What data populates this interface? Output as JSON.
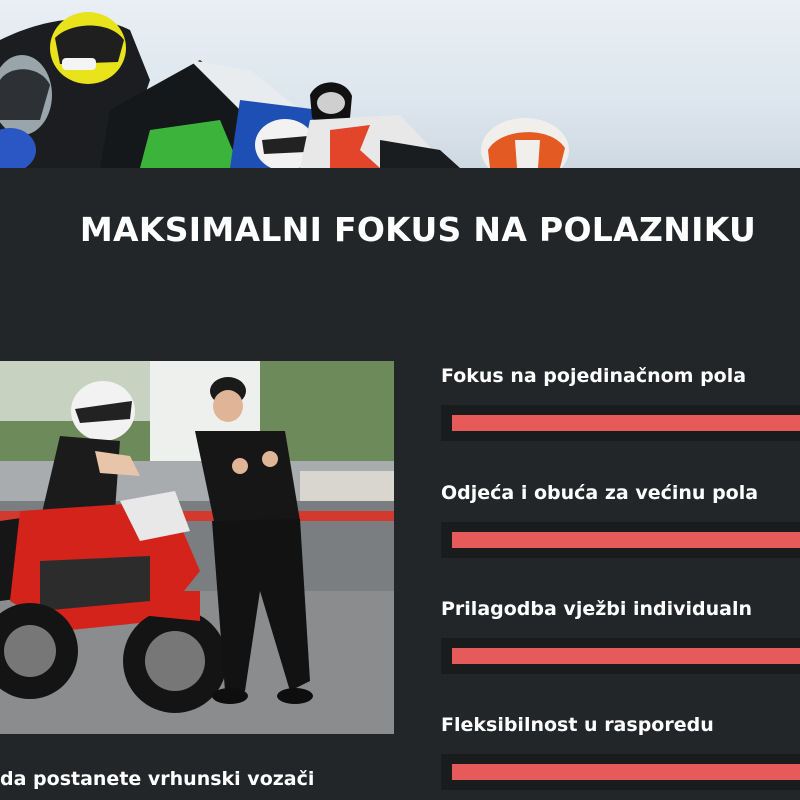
{
  "section": {
    "title": "MAKSIMALNI FOKUS NA POLAZNIKU"
  },
  "photo": {
    "caption": "da postanete vrhunski vozači"
  },
  "skills": [
    {
      "label": "Fokus na pojedinačnom pola",
      "level": 1.0
    },
    {
      "label": "Odjeća i obuća za većinu pola",
      "level": 1.0
    },
    {
      "label": "Prilagodba vježbi individualn",
      "level": 1.0
    },
    {
      "label": "Fleksibilnost u rasporedu",
      "level": 1.0
    }
  ],
  "colors": {
    "background": "#232629",
    "bar_fill": "#e65a5a",
    "bar_track": "#191b1d",
    "text": "#ffffff"
  }
}
